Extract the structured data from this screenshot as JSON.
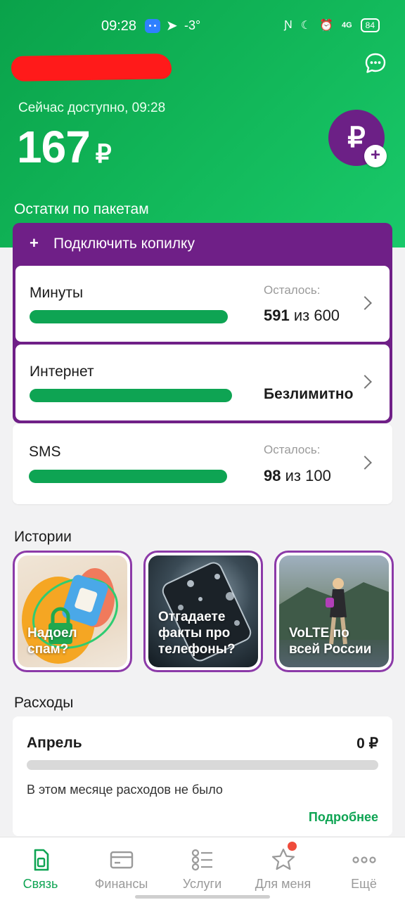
{
  "status_bar": {
    "time": "09:28",
    "temperature": "-3°",
    "network": "4G",
    "battery": "84"
  },
  "header": {
    "available_label": "Сейчас доступно, 09:28",
    "balance_amount": "167",
    "balance_currency": "₽",
    "topup_symbol": "₽",
    "topup_plus": "+",
    "chat_icon": "chat-bubble-icon"
  },
  "packages": {
    "section_title": "Остатки по пакетам",
    "piggy_bank": {
      "plus": "+",
      "label": "Подключить копилку"
    },
    "items": [
      {
        "name": "Минуты",
        "remain_label": "Осталось:",
        "value": "591",
        "of": "из 600",
        "fraction": 0.985
      },
      {
        "name": "Интернет",
        "unlimited_label": "Безлимитно",
        "fraction": 1.0
      },
      {
        "name": "SMS",
        "remain_label": "Осталось:",
        "value": "98",
        "of": "из 100",
        "fraction": 0.98
      }
    ]
  },
  "stories": {
    "section_title": "Истории",
    "items": [
      {
        "title": "Надоел спам?"
      },
      {
        "title": "Отгадаете факты про телефоны?"
      },
      {
        "title": "VoLTE по всей России"
      }
    ]
  },
  "expenses": {
    "section_title": "Расходы",
    "month": "Апрель",
    "amount": "0 ₽",
    "fraction": 0,
    "note": "В этом месяце расходов не было",
    "more_link": "Подробнее"
  },
  "bottom_nav": {
    "items": [
      {
        "label": "Связь",
        "icon": "sim-card-icon",
        "active": true
      },
      {
        "label": "Финансы",
        "icon": "wallet-icon"
      },
      {
        "label": "Услуги",
        "icon": "services-list-icon"
      },
      {
        "label": "Для меня",
        "icon": "star-icon",
        "badge": true
      },
      {
        "label": "Ещё",
        "icon": "more-dots-icon"
      }
    ]
  },
  "colors": {
    "brand_green": "#0ea453",
    "brand_purple": "#6f1f87"
  }
}
